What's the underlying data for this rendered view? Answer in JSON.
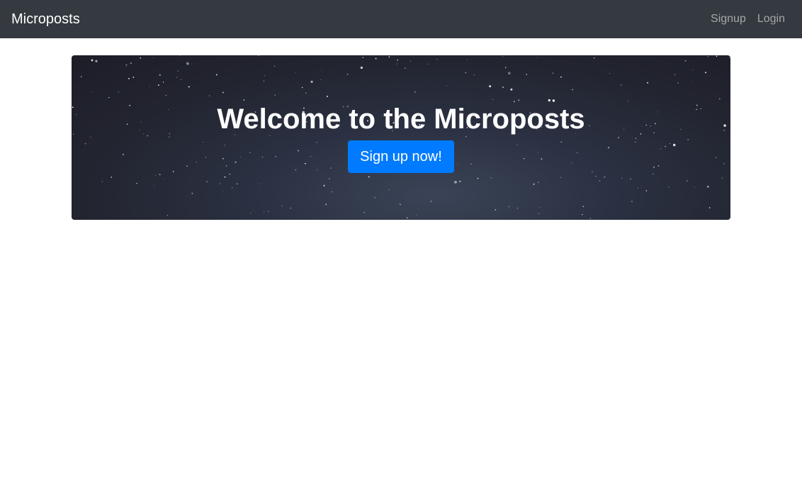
{
  "navbar": {
    "brand": "Microposts",
    "links": [
      {
        "label": "Signup"
      },
      {
        "label": "Login"
      }
    ]
  },
  "jumbotron": {
    "title": "Welcome to the Microposts",
    "button_label": "Sign up now!"
  },
  "colors": {
    "navbar_bg": "#343a40",
    "primary": "#007bff"
  }
}
